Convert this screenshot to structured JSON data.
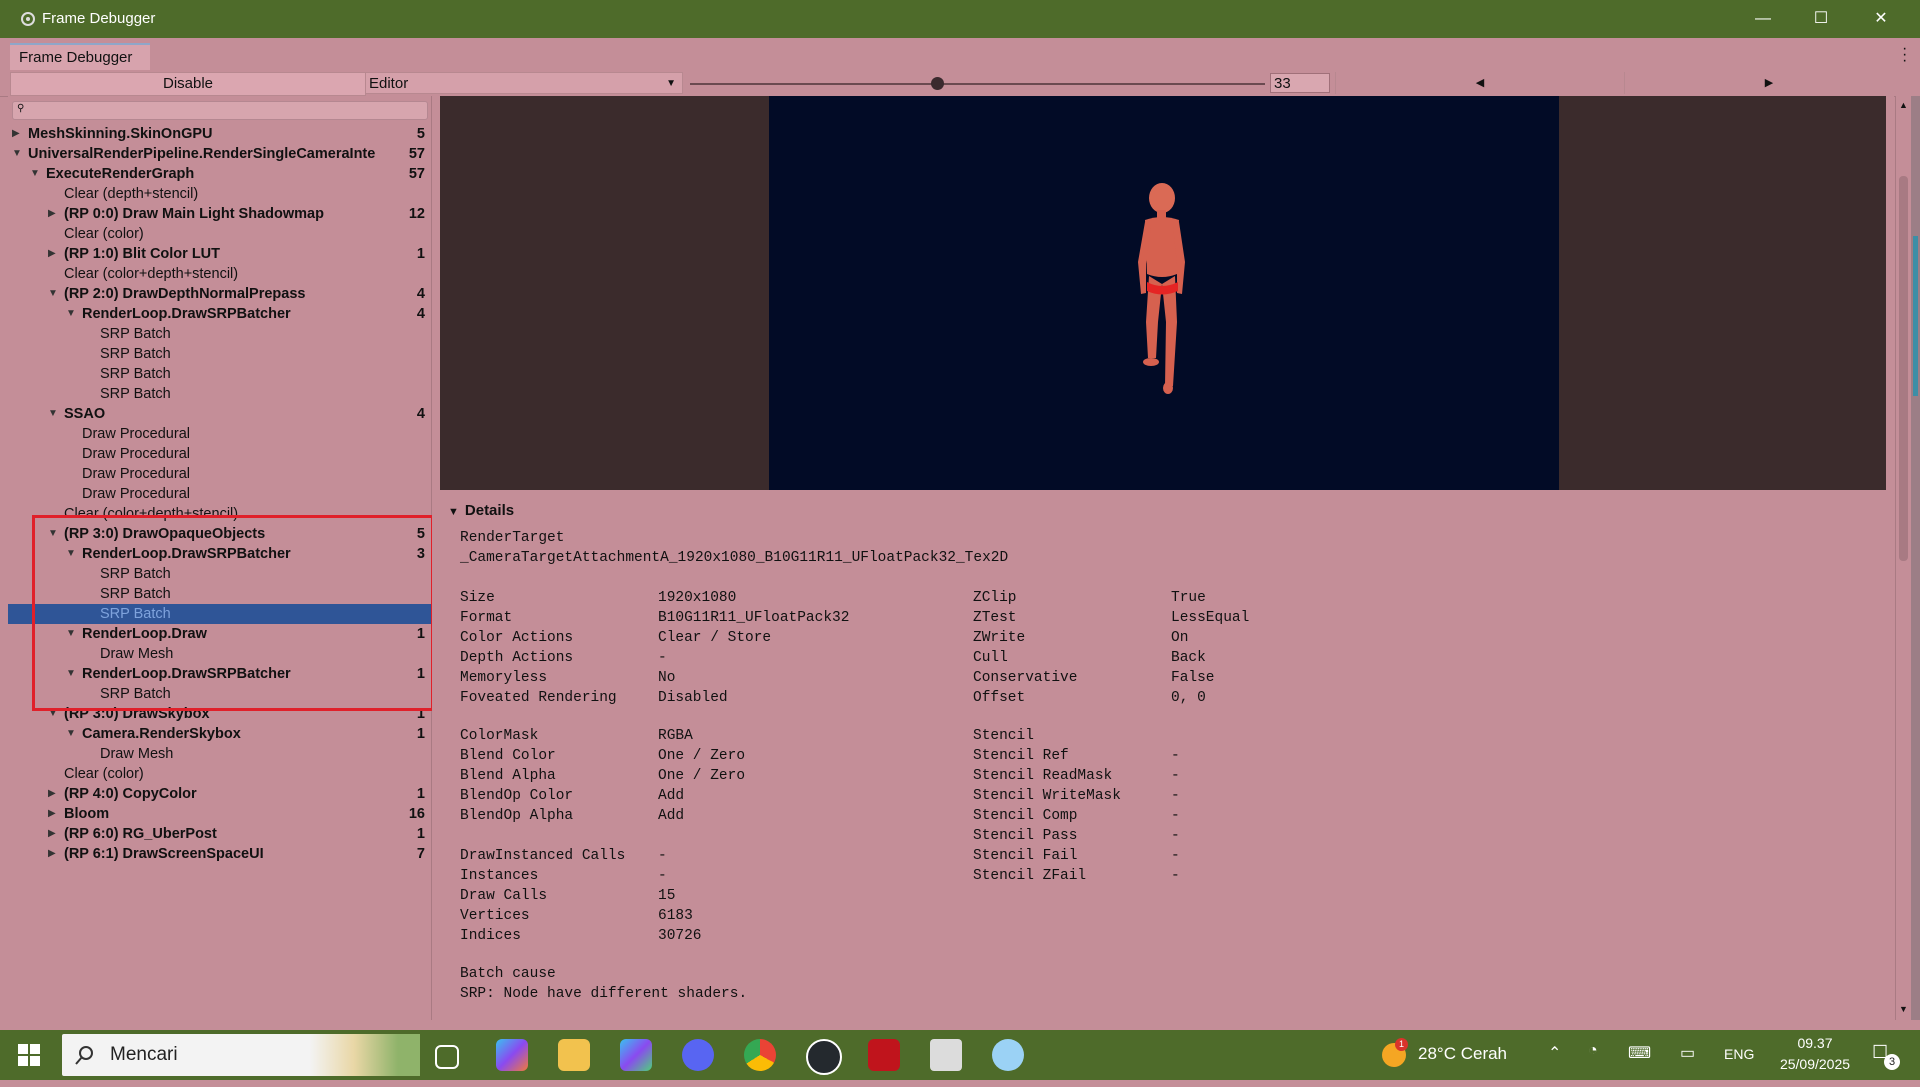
{
  "window": {
    "title": "Frame Debugger",
    "tab": "Frame Debugger",
    "minimize": "—",
    "maximize": "☐",
    "close": "✕"
  },
  "toolbar": {
    "disable_label": "Disable",
    "target_label": "Editor",
    "frame_value": "33",
    "slider_fraction": 0.43
  },
  "tree": [
    {
      "label": "MeshSkinning.SkinOnGPU",
      "count": "5",
      "indent": 0,
      "arrow": "right",
      "bold": true
    },
    {
      "label": "UniversalRenderPipeline.RenderSingleCameraInte",
      "count": "57",
      "indent": 0,
      "arrow": "down",
      "bold": true
    },
    {
      "label": "ExecuteRenderGraph",
      "count": "57",
      "indent": 1,
      "arrow": "down",
      "bold": true
    },
    {
      "label": "Clear (depth+stencil)",
      "count": "",
      "indent": 2,
      "arrow": "",
      "bold": false
    },
    {
      "label": "(RP 0:0) Draw Main Light Shadowmap",
      "count": "12",
      "indent": 2,
      "arrow": "right",
      "bold": true
    },
    {
      "label": "Clear (color)",
      "count": "",
      "indent": 2,
      "arrow": "",
      "bold": false
    },
    {
      "label": "(RP 1:0) Blit Color LUT",
      "count": "1",
      "indent": 2,
      "arrow": "right",
      "bold": true
    },
    {
      "label": "Clear (color+depth+stencil)",
      "count": "",
      "indent": 2,
      "arrow": "",
      "bold": false
    },
    {
      "label": "(RP 2:0) DrawDepthNormalPrepass",
      "count": "4",
      "indent": 2,
      "arrow": "down",
      "bold": true
    },
    {
      "label": "RenderLoop.DrawSRPBatcher",
      "count": "4",
      "indent": 3,
      "arrow": "down",
      "bold": true
    },
    {
      "label": "SRP Batch",
      "count": "",
      "indent": 4,
      "arrow": "",
      "bold": false
    },
    {
      "label": "SRP Batch",
      "count": "",
      "indent": 4,
      "arrow": "",
      "bold": false
    },
    {
      "label": "SRP Batch",
      "count": "",
      "indent": 4,
      "arrow": "",
      "bold": false
    },
    {
      "label": "SRP Batch",
      "count": "",
      "indent": 4,
      "arrow": "",
      "bold": false
    },
    {
      "label": "SSAO",
      "count": "4",
      "indent": 2,
      "arrow": "down",
      "bold": true
    },
    {
      "label": "Draw Procedural",
      "count": "",
      "indent": 3,
      "arrow": "",
      "bold": false
    },
    {
      "label": "Draw Procedural",
      "count": "",
      "indent": 3,
      "arrow": "",
      "bold": false
    },
    {
      "label": "Draw Procedural",
      "count": "",
      "indent": 3,
      "arrow": "",
      "bold": false
    },
    {
      "label": "Draw Procedural",
      "count": "",
      "indent": 3,
      "arrow": "",
      "bold": false
    },
    {
      "label": "Clear (color+depth+stencil)",
      "count": "",
      "indent": 2,
      "arrow": "",
      "bold": false
    },
    {
      "label": "(RP 3:0) DrawOpaqueObjects",
      "count": "5",
      "indent": 2,
      "arrow": "down",
      "bold": true
    },
    {
      "label": "RenderLoop.DrawSRPBatcher",
      "count": "3",
      "indent": 3,
      "arrow": "down",
      "bold": true
    },
    {
      "label": "SRP Batch",
      "count": "",
      "indent": 4,
      "arrow": "",
      "bold": false
    },
    {
      "label": "SRP Batch",
      "count": "",
      "indent": 4,
      "arrow": "",
      "bold": false
    },
    {
      "label": "SRP Batch",
      "count": "",
      "indent": 4,
      "arrow": "",
      "bold": false,
      "selected": true
    },
    {
      "label": "RenderLoop.Draw",
      "count": "1",
      "indent": 3,
      "arrow": "down",
      "bold": true
    },
    {
      "label": "Draw Mesh",
      "count": "",
      "indent": 4,
      "arrow": "",
      "bold": false
    },
    {
      "label": "RenderLoop.DrawSRPBatcher",
      "count": "1",
      "indent": 3,
      "arrow": "down",
      "bold": true
    },
    {
      "label": "SRP Batch",
      "count": "",
      "indent": 4,
      "arrow": "",
      "bold": false
    },
    {
      "label": "(RP 3:0) DrawSkybox",
      "count": "1",
      "indent": 2,
      "arrow": "down",
      "bold": true
    },
    {
      "label": "Camera.RenderSkybox",
      "count": "1",
      "indent": 3,
      "arrow": "down",
      "bold": true
    },
    {
      "label": "Draw Mesh",
      "count": "",
      "indent": 4,
      "arrow": "",
      "bold": false
    },
    {
      "label": "Clear (color)",
      "count": "",
      "indent": 2,
      "arrow": "",
      "bold": false
    },
    {
      "label": "(RP 4:0) CopyColor",
      "count": "1",
      "indent": 2,
      "arrow": "right",
      "bold": true
    },
    {
      "label": "Bloom",
      "count": "16",
      "indent": 2,
      "arrow": "right",
      "bold": true
    },
    {
      "label": "(RP 6:0) RG_UberPost",
      "count": "1",
      "indent": 2,
      "arrow": "right",
      "bold": true
    },
    {
      "label": "(RP 6:1) DrawScreenSpaceUI",
      "count": "7",
      "indent": 2,
      "arrow": "right",
      "bold": true
    }
  ],
  "details": {
    "header": "Details",
    "render_target_label": "RenderTarget",
    "render_target_value": "_CameraTargetAttachmentA_1920x1080_B10G11R11_UFloatPack32_Tex2D",
    "left_group1": [
      [
        "Size",
        "1920x1080"
      ],
      [
        "Format",
        "B10G11R11_UFloatPack32"
      ],
      [
        "Color Actions",
        "Clear / Store"
      ],
      [
        "Depth Actions",
        "-"
      ],
      [
        "Memoryless",
        "No"
      ],
      [
        "Foveated Rendering",
        "Disabled"
      ]
    ],
    "right_group1": [
      [
        "ZClip",
        "True"
      ],
      [
        "ZTest",
        "LessEqual"
      ],
      [
        "ZWrite",
        "On"
      ],
      [
        "Cull",
        "Back"
      ],
      [
        "Conservative",
        "False"
      ],
      [
        "Offset",
        "0, 0"
      ]
    ],
    "left_group2": [
      [
        "ColorMask",
        "RGBA"
      ],
      [
        "Blend Color",
        "One / Zero"
      ],
      [
        "Blend Alpha",
        "One / Zero"
      ],
      [
        "BlendOp Color",
        "Add"
      ],
      [
        "BlendOp Alpha",
        "Add"
      ]
    ],
    "right_group2": [
      [
        "Stencil",
        ""
      ],
      [
        "Stencil Ref",
        "-"
      ],
      [
        "Stencil ReadMask",
        "-"
      ],
      [
        "Stencil WriteMask",
        "-"
      ],
      [
        "Stencil Comp",
        "-"
      ],
      [
        "Stencil Pass",
        "-"
      ],
      [
        "Stencil Fail",
        "-"
      ],
      [
        "Stencil ZFail",
        "-"
      ]
    ],
    "left_group3": [
      [
        "DrawInstanced Calls",
        "-"
      ],
      [
        "Instances",
        "-"
      ],
      [
        "Draw Calls",
        "15"
      ],
      [
        "Vertices",
        "6183"
      ],
      [
        "Indices",
        "30726"
      ]
    ],
    "batch_cause_label": "Batch cause",
    "batch_cause_value": "SRP: Node have different shaders."
  },
  "taskbar": {
    "search_placeholder": "Mencari",
    "weather": "28°C Cerah",
    "weather_badge": "1",
    "language": "ENG",
    "time": "09.37",
    "date": "25/09/2025",
    "notification_count": "3"
  },
  "colors": {
    "titlebar": "#4e6b2a",
    "panel": "#c48e98",
    "selection": "#2f5597",
    "highlight_box": "#e0202a",
    "viewport": "#020b26"
  }
}
